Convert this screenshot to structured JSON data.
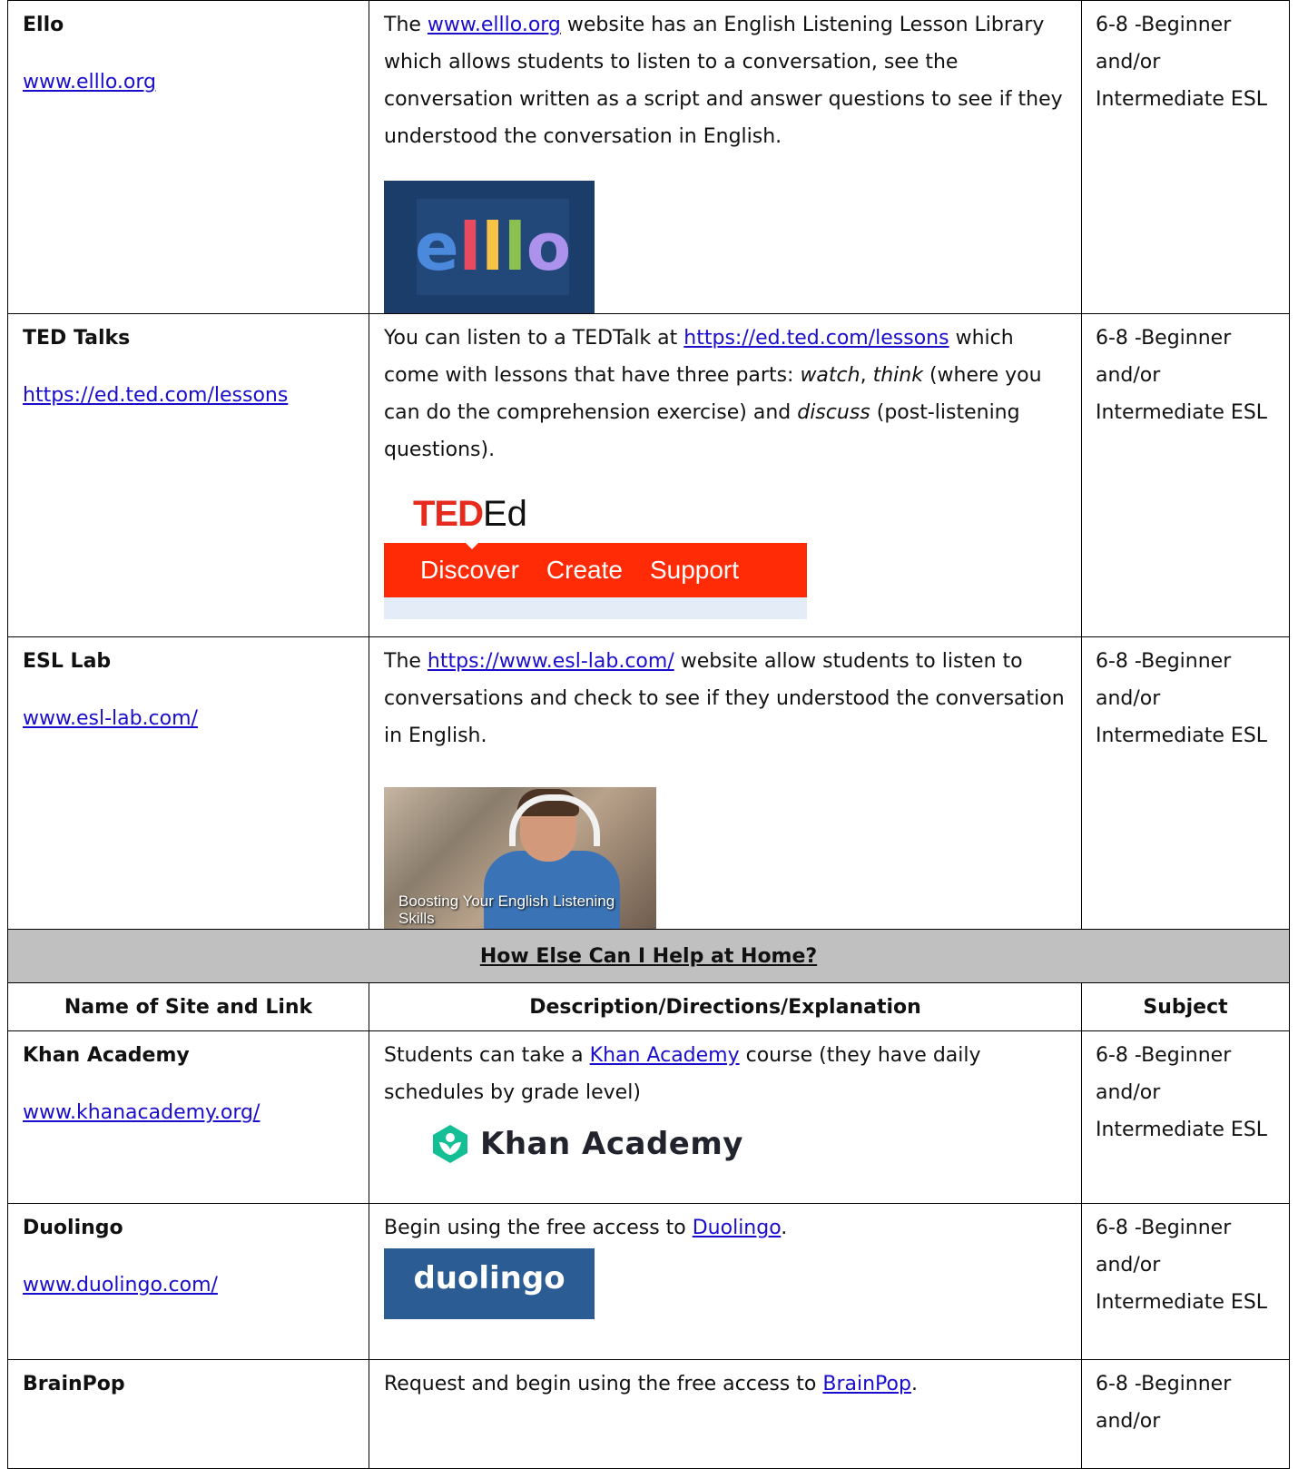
{
  "rows_top": [
    {
      "name": "Ello",
      "link": "www.elllo.org",
      "desc_before": "The ",
      "desc_link": "www.elllo.org",
      "desc_after": " website has an English Listening Lesson Library which allows students to listen to a conversation, see the conversation written as a script and answer questions to see if they understood the conversation in English.",
      "logo_text": "elllo",
      "subject": "6-8 -Beginner and/or Intermediate ESL"
    },
    {
      "name": "TED Talks",
      "link": "https://ed.ted.com/lessons",
      "desc_before": "You can listen to a TEDTalk at ",
      "desc_link": "https://ed.ted.com/lessons",
      "desc_mid1": " which come with lessons that have three parts:  ",
      "desc_em1": "watch",
      "desc_mid2": ", ",
      "desc_em2": "think",
      "desc_mid3": " (where you can do the comprehension exercise) and ",
      "desc_em3": "discuss",
      "desc_after": " (post-listening questions).",
      "logo_ted": "TED",
      "logo_ed": "Ed",
      "logo_nav": [
        "Discover",
        "Create",
        "Support"
      ],
      "subject": "6-8 -Beginner and/or Intermediate ESL"
    },
    {
      "name": "ESL Lab",
      "link": "www.esl-lab.com/",
      "desc_before": "The ",
      "desc_link": "https://www.esl-lab.com/",
      "desc_after": " website allow students to listen to conversations and check to see if they understood the conversation in English.",
      "image_caption": "Boosting Your English Listening Skills",
      "subject": "6-8 -Beginner and/or Intermediate ESL"
    }
  ],
  "section_title": "How Else Can I Help at Home?",
  "headers": [
    "Name of Site and Link",
    "Description/Directions/Explanation",
    "Subject"
  ],
  "rows_bottom": [
    {
      "name": "Khan Academy",
      "link": "www.khanacademy.org/",
      "desc_before": "Students can take a ",
      "desc_link": "Khan Academy",
      "desc_after": " course (they have daily schedules by grade level)",
      "logo_text": "Khan Academy",
      "subject": "6-8 -Beginner and/or Intermediate ESL"
    },
    {
      "name": "Duolingo",
      "link": "www.duolingo.com/",
      "desc_before": "Begin using the free access to ",
      "desc_link": "Duolingo",
      "desc_after": ".",
      "logo_text": "duolingo",
      "subject": "6-8 -Beginner and/or Intermediate ESL"
    },
    {
      "name": "BrainPop",
      "desc_before": "Request and begin using the free access to ",
      "desc_link": "BrainPop",
      "desc_after": ".",
      "subject": "6-8 -Beginner and/or"
    }
  ],
  "colors": {
    "link": "#1a0dcc",
    "section_bg": "#c0c0c0",
    "ted_red": "#e62b1e",
    "ted_bar": "#ff2b06",
    "duolingo_bg": "#2b5c94",
    "khan_green": "#14bf96",
    "elllo_letters": [
      "#4a89dc",
      "#e84a5f",
      "#f6c344",
      "#8cc152",
      "#ac92ec"
    ]
  }
}
